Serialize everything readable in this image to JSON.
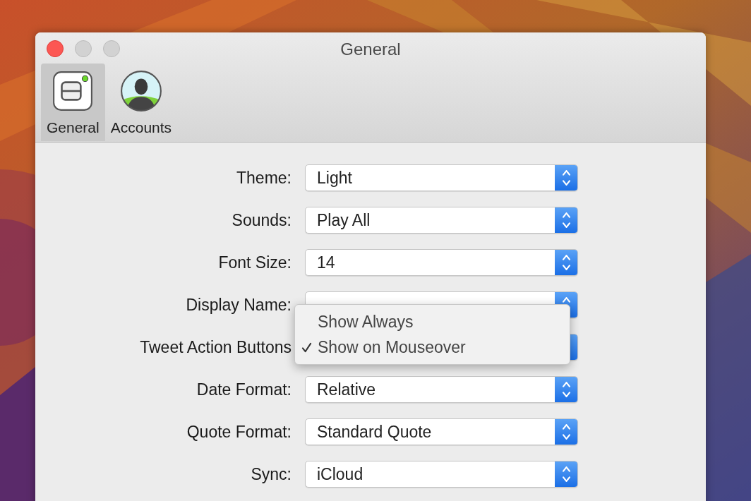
{
  "window": {
    "title": "General"
  },
  "toolbar": [
    {
      "label": "General",
      "selected": true,
      "kind": "general"
    },
    {
      "label": "Accounts",
      "selected": false,
      "kind": "accounts"
    }
  ],
  "settings": [
    {
      "label": "Theme:",
      "value": "Light"
    },
    {
      "label": "Sounds:",
      "value": "Play All"
    },
    {
      "label": "Font Size:",
      "value": "14"
    },
    {
      "label": "Display Name:"
    },
    {
      "label": "Tweet Action Buttons",
      "menu": [
        {
          "label": "Show Always",
          "checked": false
        },
        {
          "label": "Show on Mouseover",
          "checked": true
        }
      ]
    },
    {
      "label": "Date Format:",
      "value": "Relative"
    },
    {
      "label": "Quote Format:",
      "value": "Standard Quote"
    },
    {
      "label": "Sync:",
      "value": "iCloud"
    }
  ]
}
